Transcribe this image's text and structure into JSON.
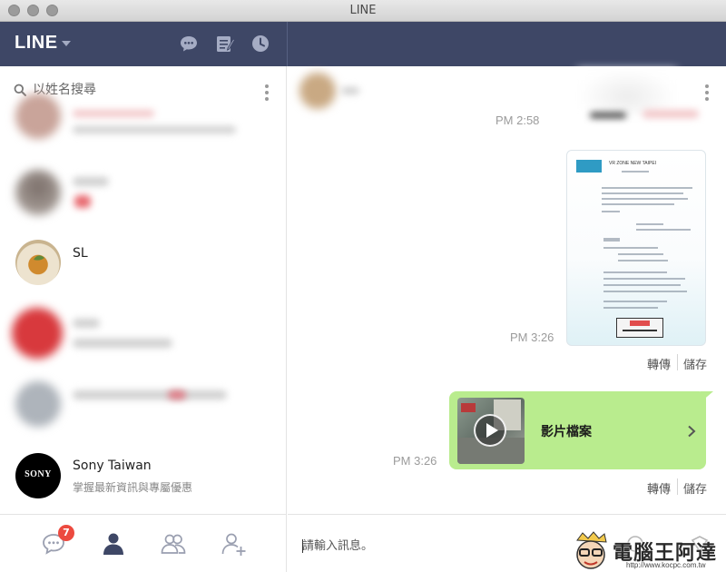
{
  "window": {
    "title": "LINE"
  },
  "header": {
    "logo": "LINE"
  },
  "search": {
    "placeholder": "以姓名搜尋"
  },
  "contacts": [
    {
      "name": "SL",
      "status": ""
    },
    {
      "name": "Sony Taiwan",
      "status": "掌握最新資訊與專屬優惠",
      "avatar_text": "SONY"
    }
  ],
  "nav": {
    "chat_badge": "7"
  },
  "chat": {
    "messages": [
      {
        "time": "PM 2:58"
      },
      {
        "time": "PM 3:26",
        "actions": {
          "forward": "轉傳",
          "save": "儲存"
        }
      },
      {
        "time": "PM 3:26",
        "label": "影片檔案",
        "actions": {
          "forward": "轉傳",
          "save": "儲存"
        }
      }
    ],
    "doc": {
      "header": "VR ZONE NEW TAIPEI"
    }
  },
  "composer": {
    "placeholder": "請輸入訊息。"
  },
  "watermark": {
    "text": "電腦王阿達",
    "url": "http://www.kocpc.com.tw"
  },
  "colors": {
    "header_bg": "#3e4766",
    "bubble_green": "#b9ec8e",
    "badge_red": "#ec4a3f"
  }
}
